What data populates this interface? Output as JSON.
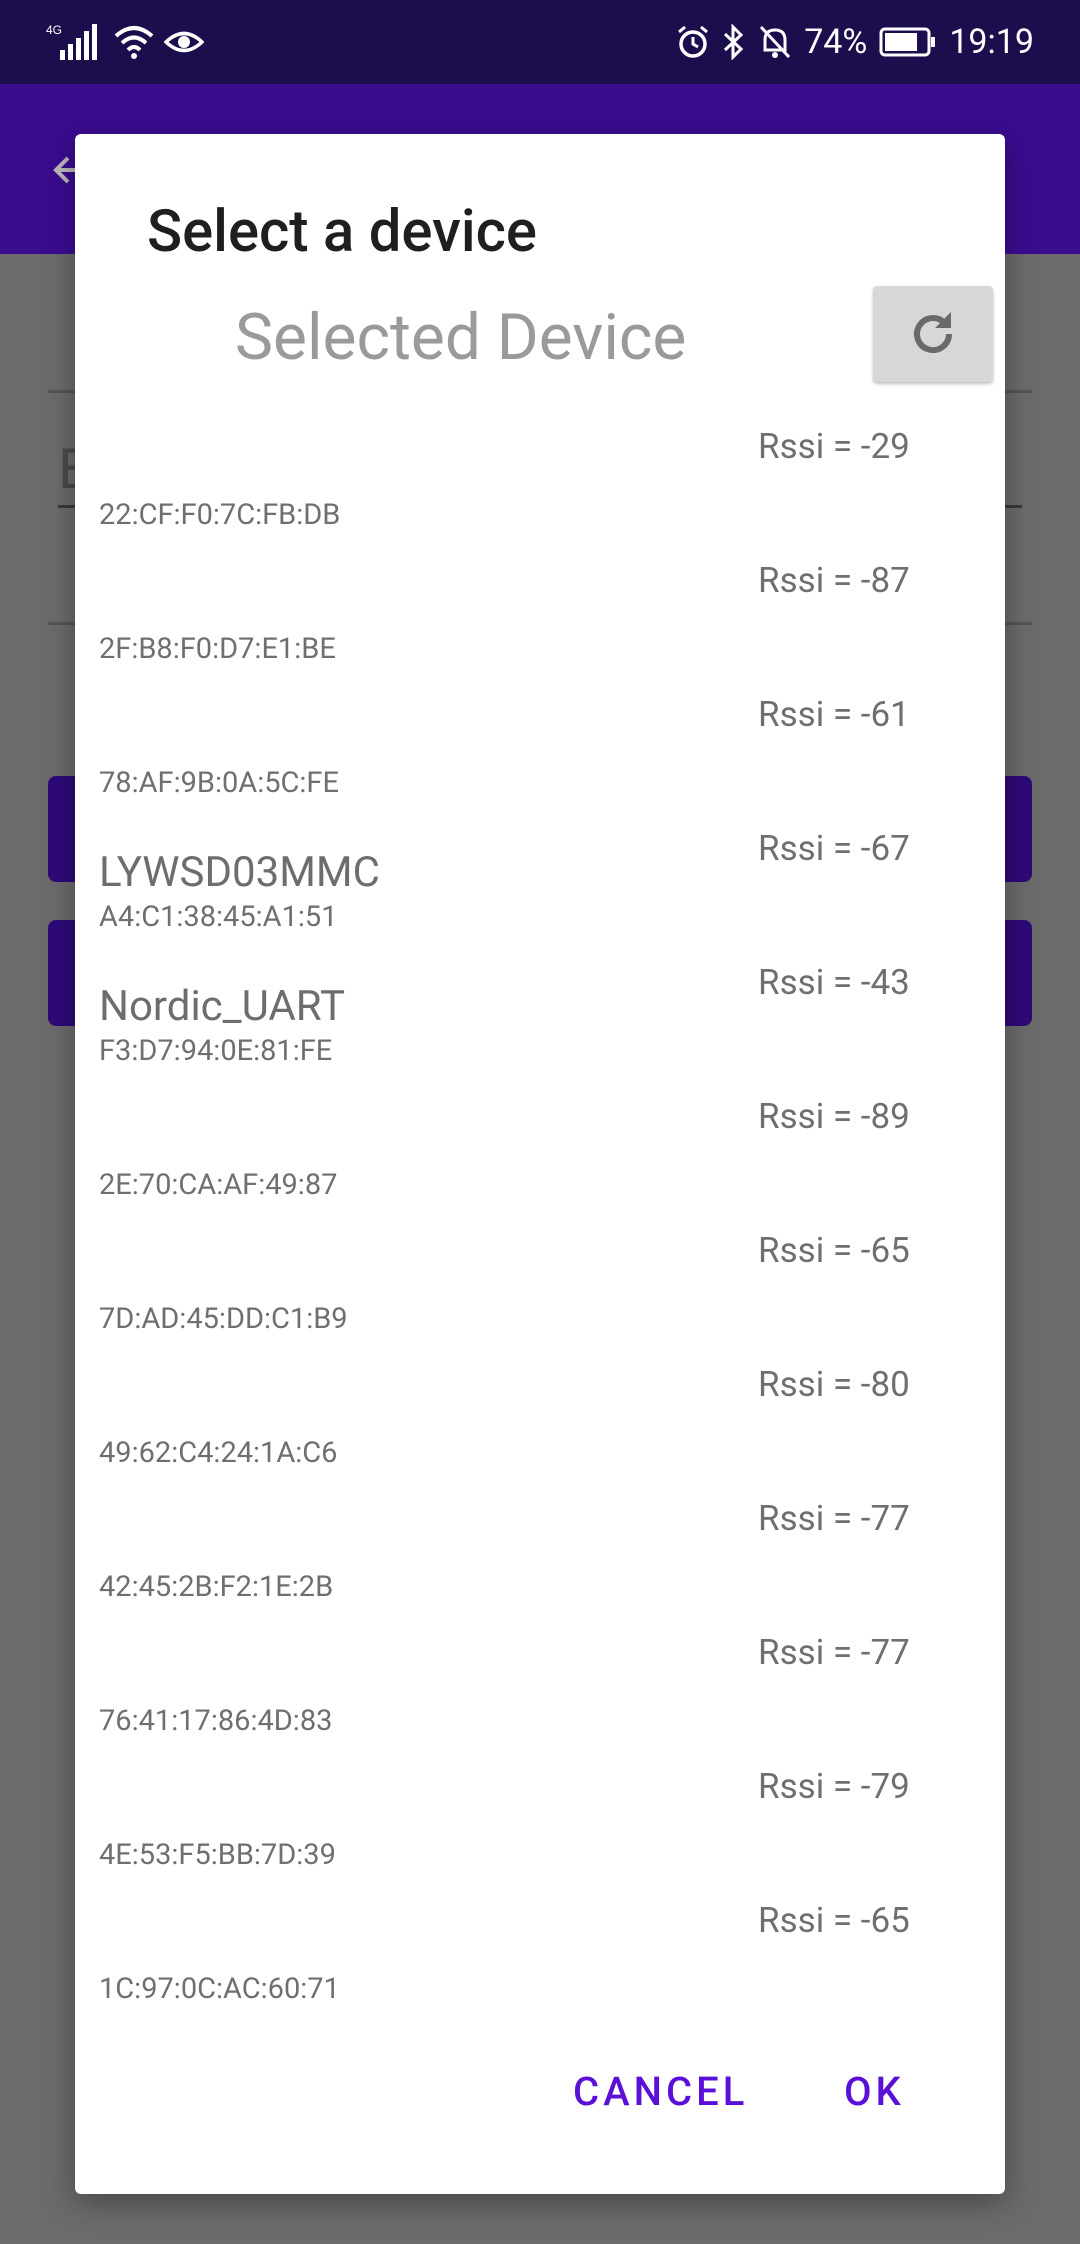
{
  "status_bar": {
    "network": "4G",
    "battery": "74%",
    "time": "19:19",
    "icons": [
      "signal-icon",
      "wifi-icon",
      "eye-icon",
      "alarm-icon",
      "bluetooth-icon",
      "bell-off-icon",
      "battery-icon"
    ]
  },
  "background": {
    "partial_text": "E",
    "accent_color": "#3a0c8f"
  },
  "dialog": {
    "title": "Select a device",
    "selected_device_label": "Selected Device",
    "refresh_icon": "refresh-icon",
    "devices": [
      {
        "name": "",
        "mac": "22:CF:F0:7C:FB:DB",
        "rssi": "Rssi = -29"
      },
      {
        "name": "",
        "mac": "2F:B8:F0:D7:E1:BE",
        "rssi": "Rssi = -87"
      },
      {
        "name": "",
        "mac": "78:AF:9B:0A:5C:FE",
        "rssi": "Rssi = -61"
      },
      {
        "name": "LYWSD03MMC",
        "mac": "A4:C1:38:45:A1:51",
        "rssi": "Rssi = -67"
      },
      {
        "name": "Nordic_UART",
        "mac": "F3:D7:94:0E:81:FE",
        "rssi": "Rssi = -43"
      },
      {
        "name": "",
        "mac": "2E:70:CA:AF:49:87",
        "rssi": "Rssi = -89"
      },
      {
        "name": "",
        "mac": "7D:AD:45:DD:C1:B9",
        "rssi": "Rssi = -65"
      },
      {
        "name": "",
        "mac": "49:62:C4:24:1A:C6",
        "rssi": "Rssi = -80"
      },
      {
        "name": "",
        "mac": "42:45:2B:F2:1E:2B",
        "rssi": "Rssi = -77"
      },
      {
        "name": "",
        "mac": "76:41:17:86:4D:83",
        "rssi": "Rssi = -77"
      },
      {
        "name": "",
        "mac": "4E:53:F5:BB:7D:39",
        "rssi": "Rssi = -79"
      },
      {
        "name": "",
        "mac": "1C:97:0C:AC:60:71",
        "rssi": "Rssi = -65"
      }
    ],
    "cancel_label": "CANCEL",
    "ok_label": "OK",
    "button_color": "#5a10d6"
  }
}
